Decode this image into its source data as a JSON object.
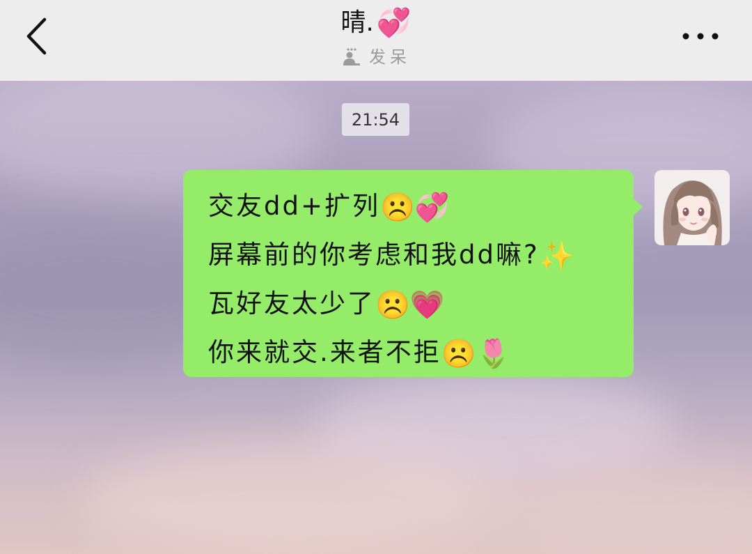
{
  "header": {
    "contact_name": "晴.",
    "contact_emoji": "💞",
    "status_text": "发呆",
    "status_icon": "idle-status-icon"
  },
  "chat": {
    "timestamp": "21:54",
    "message": {
      "lines": [
        {
          "text": "交友dd+扩列",
          "emojis": "☹️💞"
        },
        {
          "text": "屏幕前的你考虑和我dd嘛?",
          "emojis": "✨"
        },
        {
          "text": "瓦好友太少了",
          "emojis": "☹️💗"
        },
        {
          "text": "你来就交.来者不拒",
          "emojis": "☹️🌷"
        }
      ]
    }
  },
  "colors": {
    "header_bg": "#ededed",
    "bubble_green": "#95ec69",
    "timestamp_bg": "#ecebf0"
  }
}
